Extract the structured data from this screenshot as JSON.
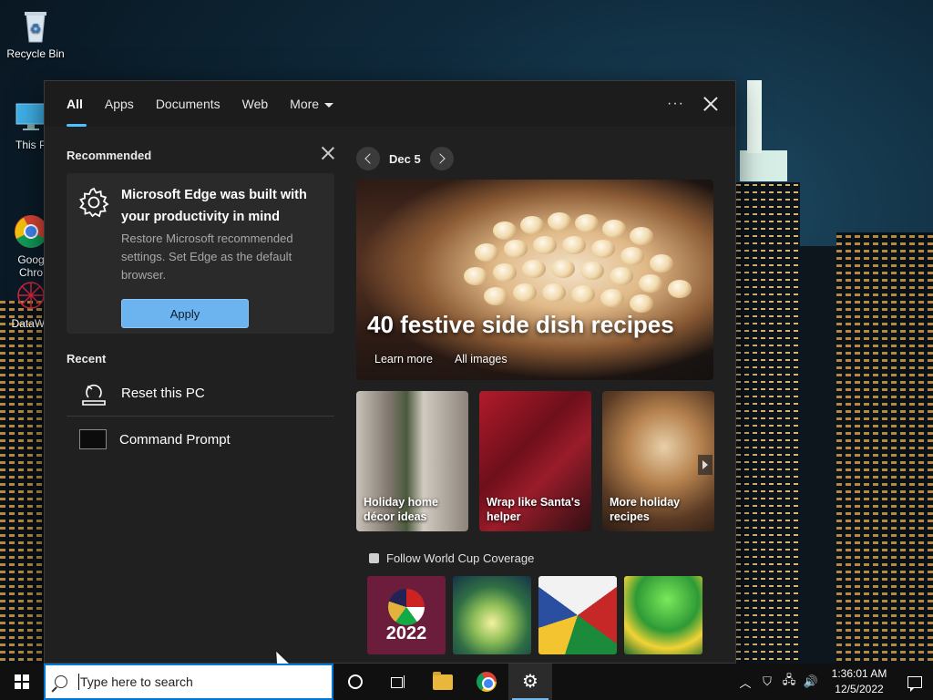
{
  "desktop": {
    "icons": [
      {
        "label": "Recycle Bin",
        "icon": "recycle-bin-icon"
      },
      {
        "label": "This P",
        "icon": "this-pc-icon"
      },
      {
        "label": "Goog\nChro",
        "icon": "chrome-icon"
      },
      {
        "label": "DataWa",
        "icon": "datawrapper-icon"
      }
    ]
  },
  "search_panel": {
    "tabs": [
      {
        "label": "All",
        "active": true
      },
      {
        "label": "Apps"
      },
      {
        "label": "Documents"
      },
      {
        "label": "Web"
      },
      {
        "label": "More"
      }
    ],
    "more_options_icon": "ellipsis-icon",
    "close_icon": "close-icon",
    "recommended": {
      "heading": "Recommended",
      "card": {
        "title": "Microsoft Edge was built with your productivity in mind",
        "description": "Restore Microsoft recommended settings. Set Edge as the default browser.",
        "button": "Apply",
        "icon": "gear-icon"
      }
    },
    "recent": {
      "heading": "Recent",
      "items": [
        {
          "label": "Reset this PC",
          "icon": "reset-pc-icon"
        },
        {
          "label": "Command Prompt",
          "icon": "command-prompt-icon"
        }
      ]
    },
    "feed": {
      "date": "Dec 5",
      "hero": {
        "title": "40 festive side dish recipes",
        "links": [
          "Learn more",
          "All images"
        ]
      },
      "tiles": [
        {
          "label": "Holiday home décor ideas"
        },
        {
          "label": "Wrap like Santa's helper"
        },
        {
          "label": "More holiday recipes"
        }
      ],
      "worldcup": {
        "heading": "Follow World Cup Coverage",
        "tile1_year": "2022"
      }
    }
  },
  "taskbar": {
    "search_placeholder": "Type here to search",
    "pinned": [
      "cortana-icon",
      "task-view-icon",
      "file-explorer-icon",
      "chrome-icon",
      "settings-icon"
    ],
    "clock": {
      "time": "1:36:01 AM",
      "date": "12/5/2022"
    }
  },
  "colors": {
    "accent": "#4cc2ff",
    "apply_button": "#6cb4f0",
    "panel_bg": "#202020",
    "taskbar_bg": "#101010"
  }
}
